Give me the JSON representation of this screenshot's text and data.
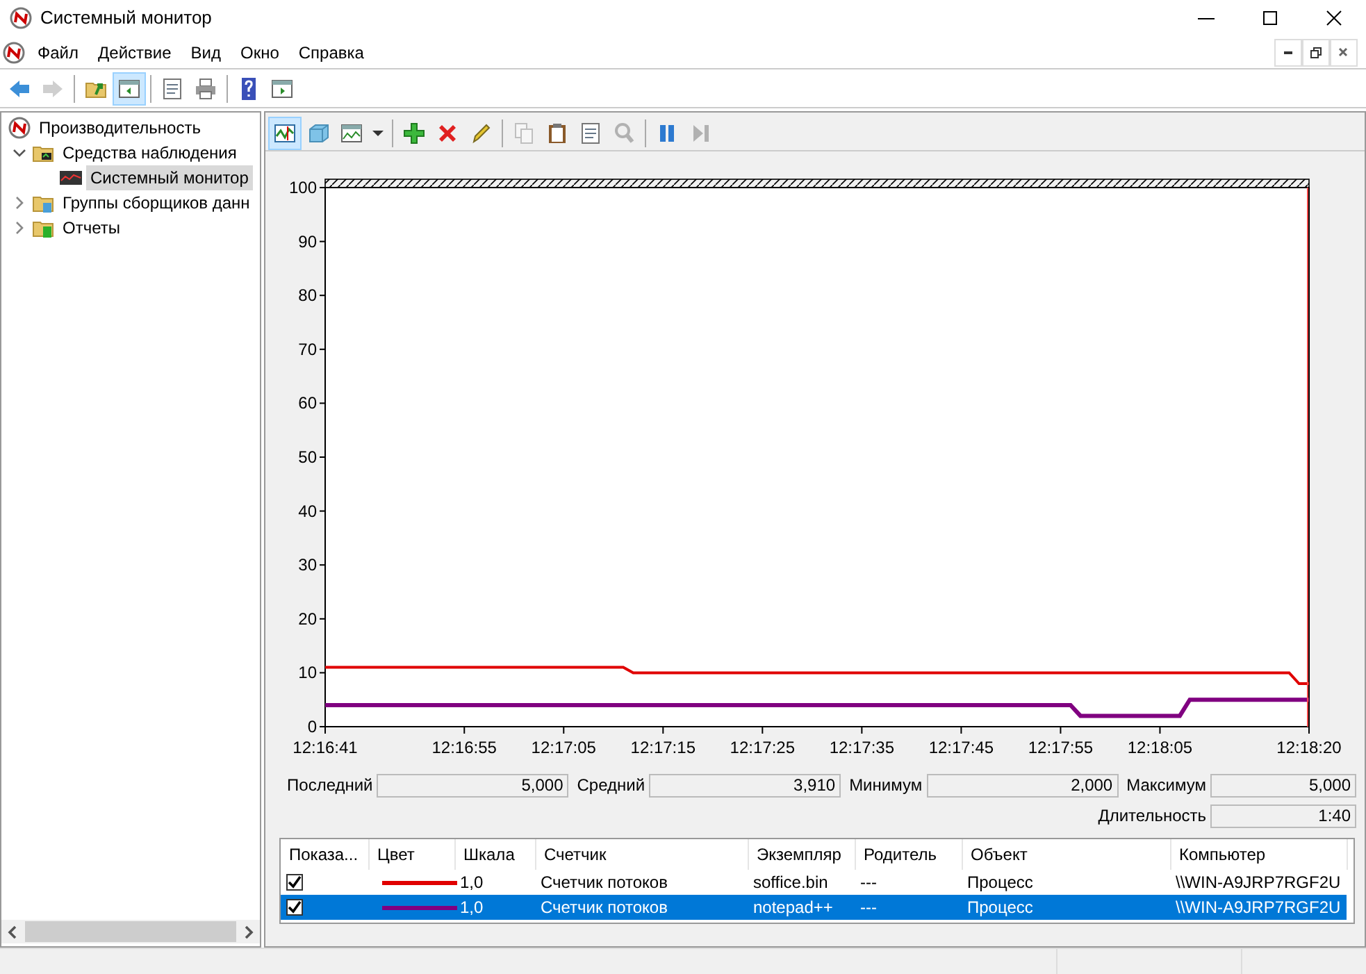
{
  "window": {
    "title": "Системный монитор"
  },
  "menu": [
    "Файл",
    "Действие",
    "Вид",
    "Окно",
    "Справка"
  ],
  "toolbar": {
    "groups": [
      {
        "buttons": [
          {
            "kind": "back",
            "pressed": false,
            "disabled": false
          },
          {
            "kind": "forward",
            "pressed": false,
            "disabled": true
          }
        ]
      },
      {
        "buttons": [
          {
            "kind": "up",
            "pressed": false,
            "disabled": false
          },
          {
            "kind": "tree",
            "pressed": true,
            "disabled": false
          }
        ]
      },
      {
        "buttons": [
          {
            "kind": "properties",
            "pressed": false,
            "disabled": false
          },
          {
            "kind": "print",
            "pressed": false,
            "disabled": false
          }
        ]
      },
      {
        "buttons": [
          {
            "kind": "help",
            "pressed": false,
            "disabled": false
          },
          {
            "kind": "panel",
            "pressed": false,
            "disabled": false
          }
        ]
      }
    ]
  },
  "tree": [
    {
      "label": "Производительность",
      "kind": "perf",
      "selected": false,
      "children": [
        {
          "label": "Средства наблюдения",
          "kind": "folder-monitor",
          "selected": false,
          "expanded": true,
          "children": [
            {
              "label": "Системный монитор",
              "kind": "monitor",
              "selected": true
            }
          ]
        },
        {
          "label": "Группы сборщиков данн",
          "kind": "folder-group",
          "selected": false,
          "expanded": false
        },
        {
          "label": "Отчеты",
          "kind": "folder-report",
          "selected": false,
          "expanded": false
        }
      ]
    }
  ],
  "graph_toolbar": {
    "groups": [
      {
        "buttons": [
          {
            "kind": "graph",
            "pressed": true,
            "disabled": false
          },
          {
            "kind": "histogram",
            "pressed": false,
            "disabled": false
          },
          {
            "kind": "report",
            "pressed": false,
            "disabled": false
          },
          {
            "kind": "dropdown",
            "pressed": false,
            "disabled": false
          }
        ]
      },
      {
        "buttons": [
          {
            "kind": "add",
            "pressed": false,
            "disabled": false
          },
          {
            "kind": "delete",
            "pressed": false,
            "disabled": false
          },
          {
            "kind": "highlight",
            "pressed": false,
            "disabled": false
          }
        ]
      },
      {
        "buttons": [
          {
            "kind": "copy",
            "pressed": false,
            "disabled": true
          },
          {
            "kind": "paste",
            "pressed": false,
            "disabled": false
          },
          {
            "kind": "properties",
            "pressed": false,
            "disabled": false
          },
          {
            "kind": "zoom",
            "pressed": false,
            "disabled": true
          }
        ]
      },
      {
        "buttons": [
          {
            "kind": "freeze",
            "pressed": false,
            "disabled": false
          },
          {
            "kind": "update",
            "pressed": false,
            "disabled": true
          }
        ]
      }
    ]
  },
  "chart_data": {
    "type": "line",
    "categories": [
      "12:16:41",
      null,
      null,
      null,
      null,
      null,
      null,
      null,
      null,
      null,
      null,
      null,
      null,
      null,
      "12:16:55",
      null,
      null,
      null,
      null,
      null,
      null,
      null,
      null,
      null,
      "12:17:05",
      null,
      null,
      null,
      null,
      null,
      null,
      null,
      null,
      null,
      "12:17:15",
      null,
      null,
      null,
      null,
      null,
      null,
      null,
      null,
      null,
      "12:17:25",
      null,
      null,
      null,
      null,
      null,
      null,
      null,
      null,
      null,
      "12:17:35",
      null,
      null,
      null,
      null,
      null,
      null,
      null,
      null,
      null,
      "12:17:45",
      null,
      null,
      null,
      null,
      null,
      null,
      null,
      null,
      null,
      "12:17:55",
      null,
      null,
      null,
      null,
      null,
      null,
      null,
      null,
      null,
      "12:18:05",
      null,
      null,
      null,
      null,
      null,
      null,
      null,
      null,
      null,
      null,
      null,
      null,
      null,
      null,
      "12:18:20"
    ],
    "series": [
      {
        "color": "#e00000",
        "values": [
          11,
          11,
          11,
          11,
          11,
          11,
          11,
          11,
          11,
          11,
          11,
          11,
          11,
          11,
          11,
          11,
          11,
          11,
          11,
          11,
          11,
          11,
          11,
          11,
          11,
          11,
          11,
          11,
          11,
          11,
          11,
          10,
          10,
          10,
          10,
          10,
          10,
          10,
          10,
          10,
          10,
          10,
          10,
          10,
          10,
          10,
          10,
          10,
          10,
          10,
          10,
          10,
          10,
          10,
          10,
          10,
          10,
          10,
          10,
          10,
          10,
          10,
          10,
          10,
          10,
          10,
          10,
          10,
          10,
          10,
          10,
          10,
          10,
          10,
          10,
          10,
          10,
          10,
          10,
          10,
          10,
          10,
          10,
          10,
          10,
          10,
          10,
          10,
          10,
          10,
          10,
          10,
          10,
          10,
          10,
          10,
          10,
          10,
          8,
          8
        ]
      },
      {
        "color": "#800080",
        "values": [
          4,
          4,
          4,
          4,
          4,
          4,
          4,
          4,
          4,
          4,
          4,
          4,
          4,
          4,
          4,
          4,
          4,
          4,
          4,
          4,
          4,
          4,
          4,
          4,
          4,
          4,
          4,
          4,
          4,
          4,
          4,
          4,
          4,
          4,
          4,
          4,
          4,
          4,
          4,
          4,
          4,
          4,
          4,
          4,
          4,
          4,
          4,
          4,
          4,
          4,
          4,
          4,
          4,
          4,
          4,
          4,
          4,
          4,
          4,
          4,
          4,
          4,
          4,
          4,
          4,
          4,
          4,
          4,
          4,
          4,
          4,
          4,
          4,
          4,
          4,
          4,
          2,
          2,
          2,
          2,
          2,
          2,
          2,
          2,
          2,
          2,
          2,
          5,
          5,
          5,
          5,
          5,
          5,
          5,
          5,
          5,
          5,
          5,
          5,
          5
        ]
      }
    ],
    "ylim": [
      0,
      100
    ],
    "yticks": [
      0,
      10,
      20,
      30,
      40,
      50,
      60,
      70,
      80,
      90,
      100
    ]
  },
  "stats": [
    {
      "label": "Последний",
      "value": "5,000"
    },
    {
      "label": "Средний",
      "value": "3,910"
    },
    {
      "label": "Минимум",
      "value": "2,000"
    },
    {
      "label": "Максимум",
      "value": "5,000"
    }
  ],
  "duration": {
    "label": "Длительность",
    "value": "1:40"
  },
  "counters": {
    "columns": [
      "Показа...",
      "Цвет",
      "Шкала",
      "Счетчик",
      "Экземпляр",
      "Родитель",
      "Объект",
      "Компьютер"
    ],
    "rows": [
      {
        "shown": true,
        "color": "#e00000",
        "scale": "1,0",
        "counter": "Счетчик потоков",
        "instance": "soffice.bin",
        "parent": "---",
        "object": "Процесс",
        "computer": "\\\\WIN-A9JRP7RGF2U",
        "selected": false
      },
      {
        "shown": true,
        "color": "#800080",
        "scale": "1,0",
        "counter": "Счетчик потоков",
        "instance": "notepad++",
        "parent": "---",
        "object": "Процесс",
        "computer": "\\\\WIN-A9JRP7RGF2U",
        "selected": true
      }
    ]
  }
}
